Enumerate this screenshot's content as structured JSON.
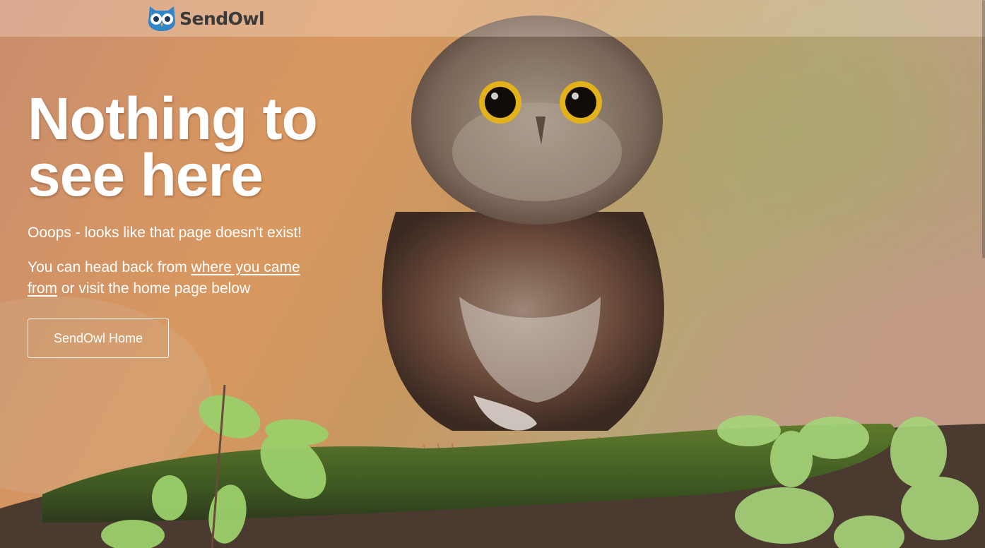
{
  "brand": {
    "name": "SendOwl",
    "icon": "owl-logo-icon"
  },
  "hero": {
    "headline_line1": "Nothing to",
    "headline_line2": "see here",
    "subtitle": "Ooops - looks like that page doesn't exist!",
    "message_prefix": "You can head back from ",
    "message_link": "where you came from",
    "message_suffix": " or visit the home page below"
  },
  "cta": {
    "label": "SendOwl Home"
  },
  "colors": {
    "text": "#ffffff",
    "logo_text": "#3a3a3a",
    "logo_blue": "#2f86c8",
    "background_warm": "#d89a66"
  },
  "image": {
    "subject": "owl-on-mossy-branch-photo"
  }
}
